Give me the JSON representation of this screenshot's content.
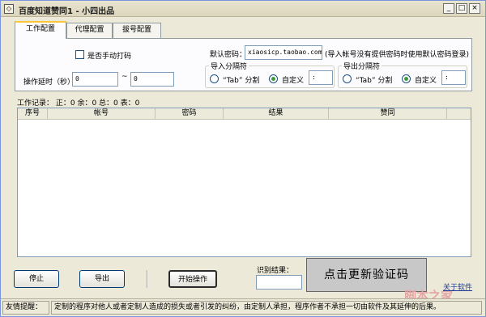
{
  "window": {
    "title": "百度知道赞同1 - 小四出品",
    "min_glyph": "_",
    "max_glyph": "□",
    "close_glyph": "×"
  },
  "tabs": [
    {
      "label": "工作配置",
      "active": true
    },
    {
      "label": "代理配置",
      "active": false
    },
    {
      "label": "拔号配置",
      "active": false
    }
  ],
  "config": {
    "manual_captcha_label": "是否手动打码",
    "delay_label": "操作延时（秒）:",
    "delay_min": "0",
    "delay_sep": "~",
    "delay_max": "0",
    "default_password_label": "默认密码：",
    "default_password_value": "xiaosicp.taobao.com",
    "default_password_hint": "(导入帐号没有提供密码时使用默认密码登录)",
    "import_sep": {
      "title": "导入分隔符",
      "tab_option": "“Tab” 分割",
      "custom_option": "自定义",
      "custom_value": ":",
      "selected": "custom"
    },
    "export_sep": {
      "title": "导出分隔符",
      "tab_option": "“Tab” 分割",
      "custom_option": "自定义",
      "custom_value": ":",
      "selected": "custom"
    }
  },
  "log": {
    "summary": "工作记录： 正：0 余：0 总：0 表：0",
    "columns": [
      "序号",
      "帐号",
      "密码",
      "结果",
      "赞同"
    ]
  },
  "actions": {
    "stop": "停止",
    "export": "导出",
    "start": "开始操作",
    "result_label": "识别结果：",
    "result_value": "",
    "captcha_text": "点击更新验证码",
    "about": "关于软件"
  },
  "watermark": "脚本之家",
  "status": {
    "label": "友情提醒：",
    "message": "定制的程序对他人或者定制人造成的损失或者引发的纠纷，由定制人承担，程序作者不承担一切由软件及其延伸的后果。"
  }
}
